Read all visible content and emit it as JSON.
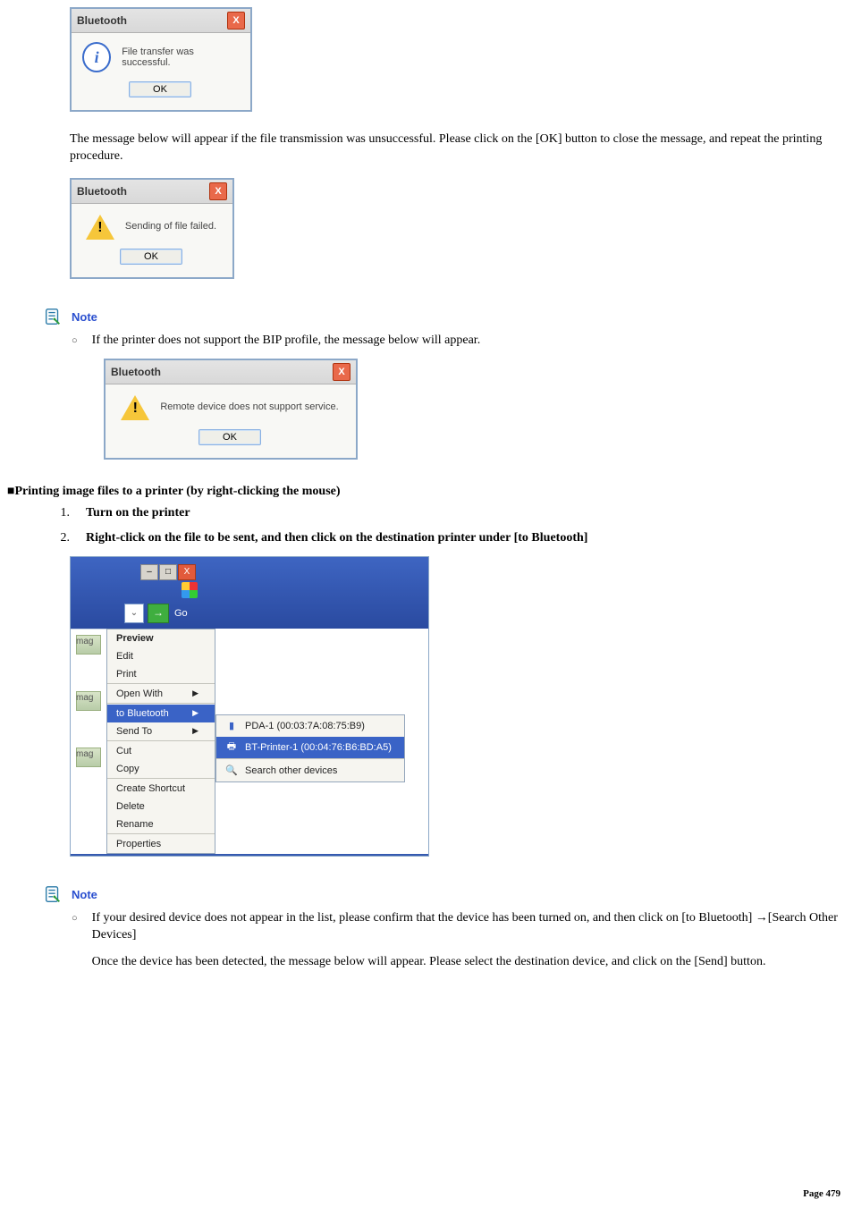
{
  "dlg1": {
    "title": "Bluetooth",
    "msg": "File transfer was successful.",
    "ok": "OK"
  },
  "para1": "The message below will appear if the file transmission was unsuccessful. Please click on the [OK] button to close the message, and repeat the printing procedure.",
  "dlg2": {
    "title": "Bluetooth",
    "msg": "Sending of file failed.",
    "ok": "OK"
  },
  "note1": {
    "label": "Note",
    "bullet": "If the printer does not support the BIP profile, the message below will appear."
  },
  "dlg3": {
    "title": "Bluetooth",
    "msg": "Remote device does not support service.",
    "ok": "OK"
  },
  "section_heading": "■Printing image files to a printer (by right-clicking the mouse)",
  "step1": "Turn on the printer",
  "step2": "Right-click on the file to be sent, and then click on the destination printer under [to Bluetooth]",
  "screenshot": {
    "go": "Go",
    "thumbs": [
      "mag",
      "mag",
      "mag"
    ],
    "ctx": {
      "preview": "Preview",
      "edit": "Edit",
      "print": "Print",
      "openwith": "Open With",
      "tobluetooth": "to Bluetooth",
      "sendto": "Send To",
      "cut": "Cut",
      "copy": "Copy",
      "createshortcut": "Create Shortcut",
      "delete": "Delete",
      "rename": "Rename",
      "properties": "Properties"
    },
    "submenu": {
      "pda": "PDA-1 (00:03:7A:08:75:B9)",
      "printer": "BT-Printer-1 (00:04:76:B6:BD:A5)",
      "search": "Search other devices"
    }
  },
  "note2": {
    "label": "Note",
    "bullet1": "If your desired device does not appear in the list, please confirm that the device has been turned on, and then click on [to Bluetooth] →[Search Other Devices]",
    "bullet2": "Once the device has been detected, the message below will appear. Please select the destination device, and click on the [Send] button."
  },
  "page": "Page 479"
}
